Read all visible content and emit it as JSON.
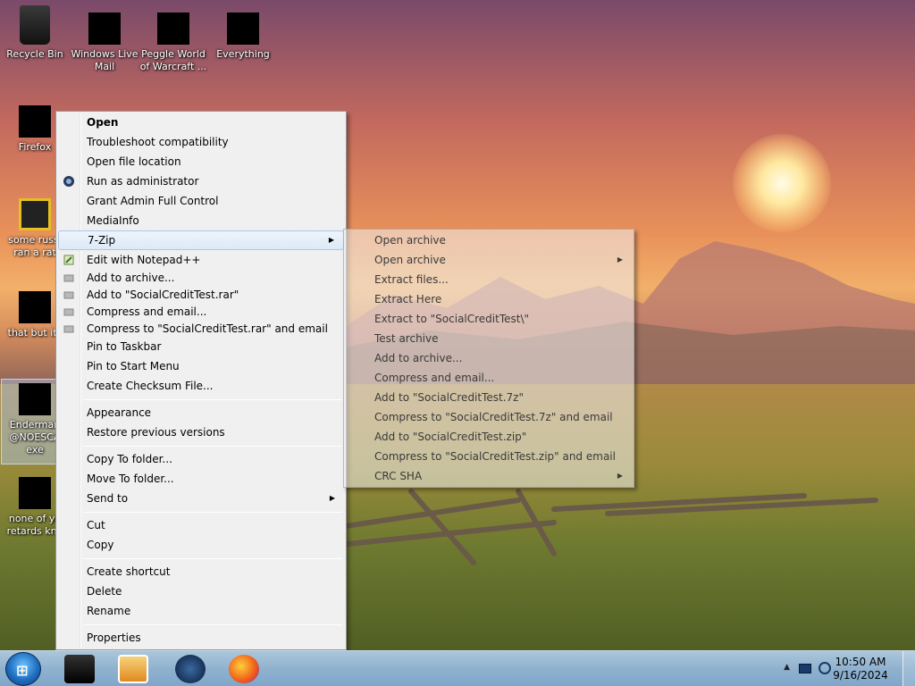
{
  "desktop": {
    "icons": [
      {
        "label": "Recycle Bin"
      },
      {
        "label": "Windows Live Mail"
      },
      {
        "label": "Peggle World of Warcraft ..."
      },
      {
        "label": "Everything"
      },
      {
        "label": "Firefox"
      },
      {
        "label": "some russi ran a rat"
      },
      {
        "label": "that but its"
      },
      {
        "label": "Enderman @NOESCA exe"
      },
      {
        "label": "none of yo retards kno"
      }
    ]
  },
  "context_menu": {
    "items": [
      {
        "label": "Open"
      },
      {
        "label": "Troubleshoot compatibility"
      },
      {
        "label": "Open file location"
      },
      {
        "label": "Run as administrator"
      },
      {
        "label": "Grant Admin Full Control"
      },
      {
        "label": "MediaInfo"
      },
      {
        "label": "7-Zip"
      },
      {
        "label": "Edit with Notepad++"
      },
      {
        "label": "Add to archive..."
      },
      {
        "label": "Add to \"SocialCreditTest.rar\""
      },
      {
        "label": "Compress and email..."
      },
      {
        "label": "Compress to \"SocialCreditTest.rar\" and email"
      },
      {
        "label": "Pin to Taskbar"
      },
      {
        "label": "Pin to Start Menu"
      },
      {
        "label": "Create Checksum File..."
      },
      {
        "label": "Appearance"
      },
      {
        "label": "Restore previous versions"
      },
      {
        "label": "Copy To folder..."
      },
      {
        "label": "Move To folder..."
      },
      {
        "label": "Send to"
      },
      {
        "label": "Cut"
      },
      {
        "label": "Copy"
      },
      {
        "label": "Create shortcut"
      },
      {
        "label": "Delete"
      },
      {
        "label": "Rename"
      },
      {
        "label": "Properties"
      }
    ]
  },
  "submenu_7zip": {
    "items": [
      {
        "label": "Open archive"
      },
      {
        "label": "Open archive"
      },
      {
        "label": "Extract files..."
      },
      {
        "label": "Extract Here"
      },
      {
        "label": "Extract to \"SocialCreditTest\\\""
      },
      {
        "label": "Test archive"
      },
      {
        "label": "Add to archive..."
      },
      {
        "label": "Compress and email..."
      },
      {
        "label": "Add to \"SocialCreditTest.7z\""
      },
      {
        "label": "Compress to \"SocialCreditTest.7z\" and email"
      },
      {
        "label": "Add to \"SocialCreditTest.zip\""
      },
      {
        "label": "Compress to \"SocialCreditTest.zip\" and email"
      },
      {
        "label": "CRC SHA"
      }
    ]
  },
  "taskbar": {
    "clock_time": "10:50 AM",
    "clock_date": "9/16/2024"
  },
  "colors": {
    "menu_bg": "#f0f0f0",
    "menu_hover": "#dde9f7",
    "taskbar": "#9ebedf"
  }
}
